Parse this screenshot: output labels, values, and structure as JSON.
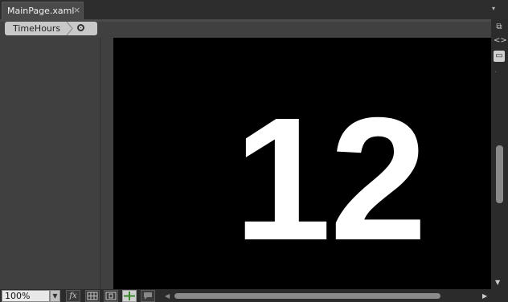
{
  "document_tab": {
    "title": "MainPage.xaml",
    "close_glyph": "×"
  },
  "tab_menu_glyph": "▾",
  "breadcrumb": {
    "item": "TimeHours",
    "scope_icon": "scope-icon"
  },
  "artboard": {
    "text": "12"
  },
  "right_rail": {
    "icons": [
      "split-view-icon",
      "xaml-view-icon",
      "design-view-icon"
    ]
  },
  "status_bar": {
    "zoom": "100%",
    "tools": [
      "fx-effects-icon",
      "show-grid-icon",
      "snap-to-grid-icon",
      "snap-to-snaplines-icon",
      "annotations-icon"
    ]
  },
  "colors": {
    "canvas": "#000000",
    "text": "#ffffff",
    "chrome": "#333333"
  }
}
